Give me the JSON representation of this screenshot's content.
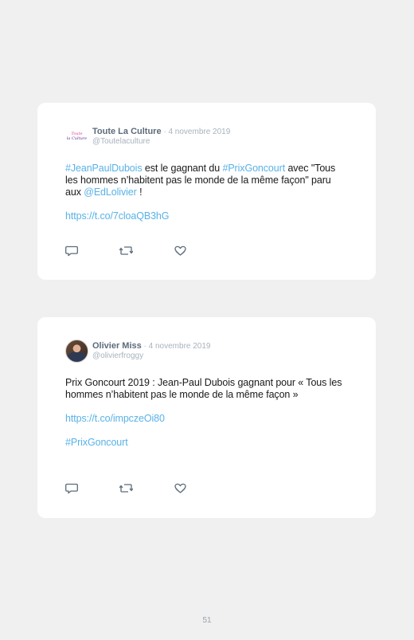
{
  "tweets": [
    {
      "author_name": "Toute La Culture",
      "date_sep": " · ",
      "date": "4 novembre 2019",
      "handle": "@Toutelaculture",
      "avatar_logo": [
        "Toute",
        "la Culture"
      ],
      "text": {
        "p1": {
          "hashtag1": "#JeanPaulDubois",
          "t1": " est le gagnant du ",
          "hashtag2": "#PrixGoncourt",
          "t2": " avec \"Tous les hommes n’habitent pas le monde de la même façon\" paru aux ",
          "mention": "@EdLolivier",
          "t3": " !"
        },
        "link": "https://t.co/7cloaQB3hG"
      },
      "actions": [
        "reply-icon",
        "retweet-icon",
        "like-icon"
      ]
    },
    {
      "author_name": "Olivier Miss",
      "date_sep": " · ",
      "date": "4 novembre 2019",
      "handle": "@olivierfroggy",
      "text": {
        "p1": "Prix Goncourt 2019 : Jean-Paul Dubois gagnant pour « Tous les hommes n’habitent pas le monde de la même façon »",
        "link": "https://t.co/impczeOi80",
        "hashtag": "#PrixGoncourt"
      },
      "actions": [
        "reply-icon",
        "retweet-icon",
        "like-icon"
      ]
    }
  ],
  "colors": {
    "background": "#f0f0f0",
    "card": "#ffffff",
    "link": "#58b2e6",
    "author": "#5b6b7a",
    "muted": "#a7b3bd"
  },
  "page_number": "51"
}
